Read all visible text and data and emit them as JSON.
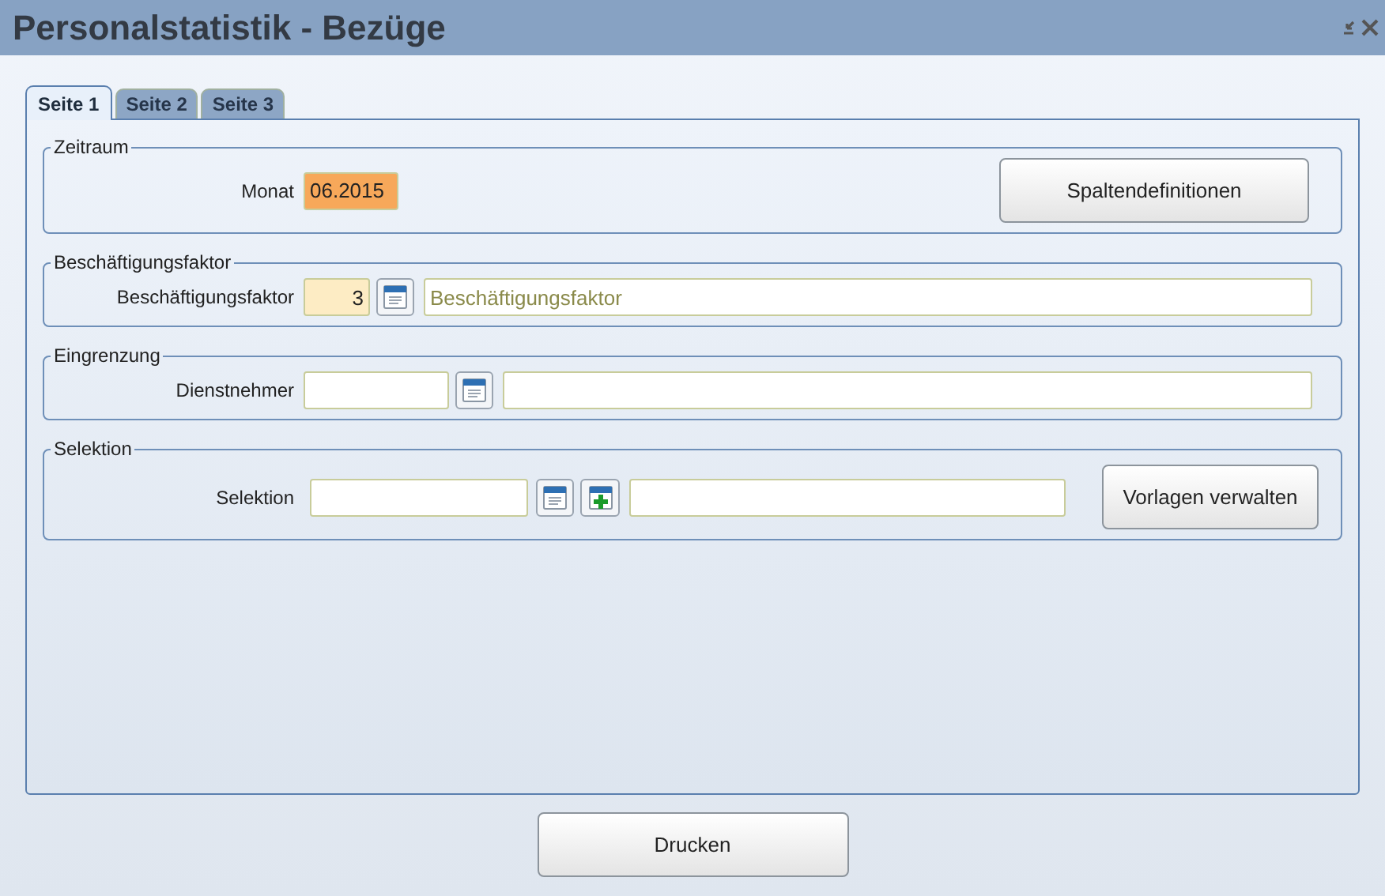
{
  "window": {
    "title": "Personalstatistik - Bezüge"
  },
  "tabs": [
    {
      "label": "Seite 1",
      "selected": true
    },
    {
      "label": "Seite 2",
      "selected": false
    },
    {
      "label": "Seite 3",
      "selected": false
    }
  ],
  "groups": [
    {
      "legend": "Zeitraum",
      "label": "Monat",
      "items": [
        {
          "kind": "field",
          "color": "#f7a85a",
          "value": "06.2015"
        },
        {
          "kind": "button",
          "label": "Spaltendefinitionen"
        }
      ]
    },
    {
      "legend": "Beschäftigungsfaktor",
      "label": "Beschäftigungsfaktor",
      "items": [
        {
          "kind": "number",
          "color": "#fdecc4",
          "value": "3"
        },
        {
          "kind": "lookup"
        },
        {
          "kind": "field",
          "placeholder": "Beschäftigungsfaktor"
        }
      ]
    },
    {
      "legend": "Eingrenzung",
      "label": "Dienstnehmer",
      "items": [
        {
          "kind": "field"
        },
        {
          "kind": "lookup"
        },
        {
          "kind": "field"
        }
      ]
    },
    {
      "legend": "Selektion",
      "label": "Selektion",
      "items": [
        {
          "kind": "field"
        },
        {
          "kind": "lookup"
        },
        {
          "kind": "add"
        },
        {
          "kind": "field"
        },
        {
          "kind": "button",
          "label": "Vorlagen verwalten"
        }
      ]
    }
  ],
  "footer": {
    "button": "Drucken"
  }
}
